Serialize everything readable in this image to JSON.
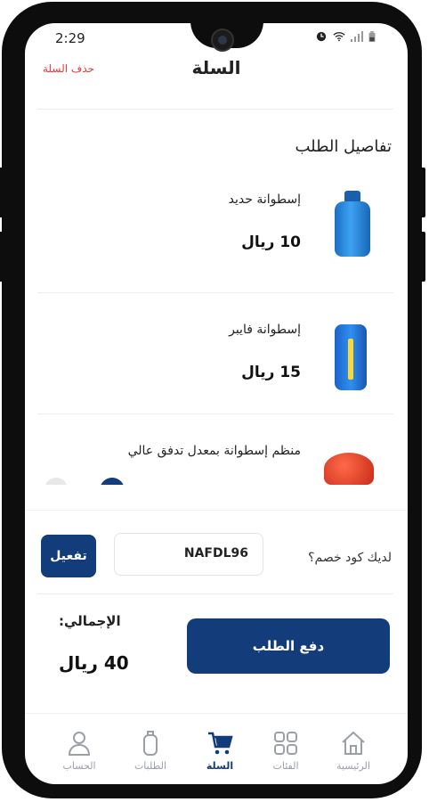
{
  "status": {
    "time": "2:29"
  },
  "header": {
    "title": "السلة",
    "clear_cart": "حذف السلة"
  },
  "order": {
    "section_title": "تفاصيل الطلب",
    "items": [
      {
        "name": "إسطوانة حديد",
        "price": "10 ريال"
      },
      {
        "name": "إسطوانة فايبر",
        "price": "15 ريال"
      },
      {
        "name": "منظم إسطوانة بمعدل تدفق عالي",
        "price": ""
      }
    ]
  },
  "coupon": {
    "label": "لديك كود خصم؟",
    "value": "NAFDL96",
    "activate_label": "تفعيل"
  },
  "checkout": {
    "total_label": "الإجمالي:",
    "total_value": "40 ريال",
    "pay_label": "دفع الطلب"
  },
  "nav": {
    "items": [
      {
        "label": "الحساب",
        "icon": "user-icon"
      },
      {
        "label": "الطلبات",
        "icon": "cylinder-icon"
      },
      {
        "label": "السلة",
        "icon": "cart-icon",
        "active": true
      },
      {
        "label": "الفئات",
        "icon": "grid-icon"
      },
      {
        "label": "الرئيسية",
        "icon": "home-icon"
      }
    ]
  },
  "colors": {
    "primary": "#123d7a",
    "danger": "#e23b3b"
  }
}
